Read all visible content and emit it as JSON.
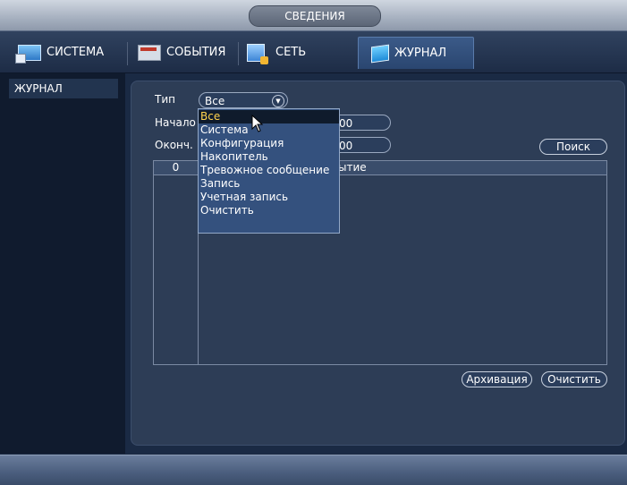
{
  "header": {
    "title": "СВЕДЕНИЯ"
  },
  "tabs": [
    {
      "label": "СИСТЕМА",
      "icon": "monitor-icon"
    },
    {
      "label": "СОБЫТИЯ",
      "icon": "events-icon"
    },
    {
      "label": "СЕТЬ",
      "icon": "network-icon"
    },
    {
      "label": "ЖУРНАЛ",
      "icon": "log-book-icon",
      "active": true
    }
  ],
  "sidebar": {
    "items": [
      {
        "label": "ЖУРНАЛ"
      }
    ]
  },
  "form": {
    "type_label": "Тип",
    "type_value": "Все",
    "start_label": "Начало",
    "start_value": "00",
    "end_label": "Оконч.",
    "end_value": "00",
    "search_button": "Поиск"
  },
  "table": {
    "col_count": "0",
    "col_event_partial": "ытие"
  },
  "dropdown": {
    "options": [
      "Все",
      "Система",
      "Конфигурация",
      "Накопитель",
      "Тревожное сообщение",
      "Запись",
      "Учетная запись",
      "Очистить"
    ],
    "selected_index": 0
  },
  "actions": {
    "archive_button": "Архивация",
    "clear_button": "Очистить"
  },
  "colors": {
    "background": "#1a2a44",
    "panel": "#2d3d56",
    "selected_text": "#ffd34d"
  }
}
